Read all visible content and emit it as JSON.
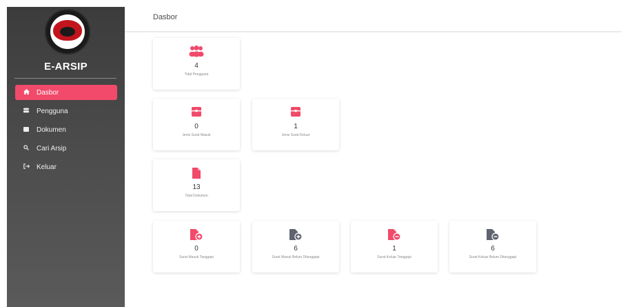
{
  "app": {
    "name": "E-ARSIP"
  },
  "sidebar": {
    "items": [
      {
        "label": "Dasbor",
        "icon": "home-icon",
        "active": true
      },
      {
        "label": "Pengguna",
        "icon": "users-icon",
        "active": false
      },
      {
        "label": "Dokumen",
        "icon": "folder-icon",
        "active": false
      },
      {
        "label": "Cari Arsip",
        "icon": "search-icon",
        "active": false
      },
      {
        "label": "Keluar",
        "icon": "logout-icon",
        "active": false
      }
    ]
  },
  "header": {
    "title": "Dasbor"
  },
  "stats": {
    "total_pengguna": {
      "value": "4",
      "label": "Total Pengguna"
    },
    "jenis_surat_masuk": {
      "value": "0",
      "label": "Jenis Surat Masuk"
    },
    "jenis_surat_keluar": {
      "value": "1",
      "label": "Jenis Surat Keluar"
    },
    "total_dokumen": {
      "value": "13",
      "label": "Total Dokumen"
    },
    "surat_masuk_tanggapi": {
      "value": "0",
      "label": "Surat Masuk Tanggapi"
    },
    "surat_masuk_belum": {
      "value": "6",
      "label": "Surat Masuk Belum Ditanggapi"
    },
    "surat_keluar_tanggapi": {
      "value": "1",
      "label": "Surat Keluar Tanggapi"
    },
    "surat_keluar_belum": {
      "value": "6",
      "label": "Surat Keluar Belum Ditanggapi"
    }
  },
  "colors": {
    "accent": "#f14a6b",
    "sidebar": "#444444",
    "muted_icon": "#5f6470"
  }
}
